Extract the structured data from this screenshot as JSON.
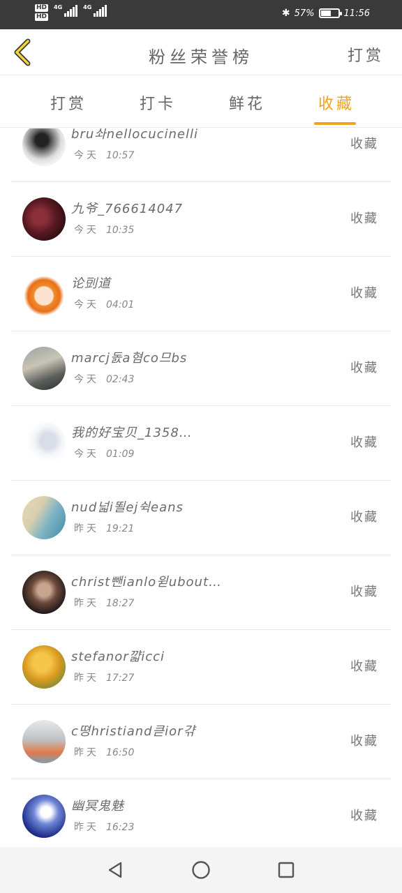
{
  "status_bar": {
    "hd1": "HD",
    "hd2": "HD",
    "network1": "4G",
    "network2": "4G",
    "battery_percent": "57%",
    "battery_level": 0.57,
    "time": "11:56",
    "icons": [
      "bluetooth-icon",
      "battery-icon",
      "signal-icon"
    ]
  },
  "header": {
    "back_icon": "chevron-left-icon",
    "title": "粉丝荣誉榜",
    "tip_label": "打赏"
  },
  "tabs": [
    {
      "label": "打赏",
      "active": false
    },
    {
      "label": "打卡",
      "active": false
    },
    {
      "label": "鲜花",
      "active": false
    },
    {
      "label": "收藏",
      "active": true
    }
  ],
  "colors": {
    "accent": "#f0a320",
    "text": "#666666",
    "divider": "#e8e8e8"
  },
  "list": {
    "items": [
      {
        "name": "bru솨nellocucinelli",
        "day": "今天",
        "time": "10:57",
        "action": "收藏"
      },
      {
        "name": "九爷_766614047",
        "day": "今天",
        "time": "10:35",
        "action": "收藏"
      },
      {
        "name": "论剅道",
        "day": "今天",
        "time": "04:01",
        "action": "收藏"
      },
      {
        "name": "marcj돐a혐co므bs",
        "day": "今天",
        "time": "02:43",
        "action": "收藏"
      },
      {
        "name": "我的好宝贝_1358…",
        "day": "今天",
        "time": "01:09",
        "action": "收藏"
      },
      {
        "name": "nud넓i뙬ej쉭eans",
        "day": "昨天",
        "time": "19:21",
        "action": "收藏"
      },
      {
        "name": "christ뺀ianlo윋ubout…",
        "day": "昨天",
        "time": "18:27",
        "action": "收藏"
      },
      {
        "name": "stefanor꺏icci",
        "day": "昨天",
        "time": "17:27",
        "action": "收藏"
      },
      {
        "name": "c뗭hristiand큳ior갺",
        "day": "昨天",
        "time": "16:50",
        "action": "收藏"
      },
      {
        "name": "幽冥鬼魅",
        "day": "昨天",
        "time": "16:23",
        "action": "收藏"
      }
    ]
  },
  "nav_bar": {
    "icons": [
      "back-triangle-icon",
      "home-circle-icon",
      "recents-square-icon"
    ]
  }
}
